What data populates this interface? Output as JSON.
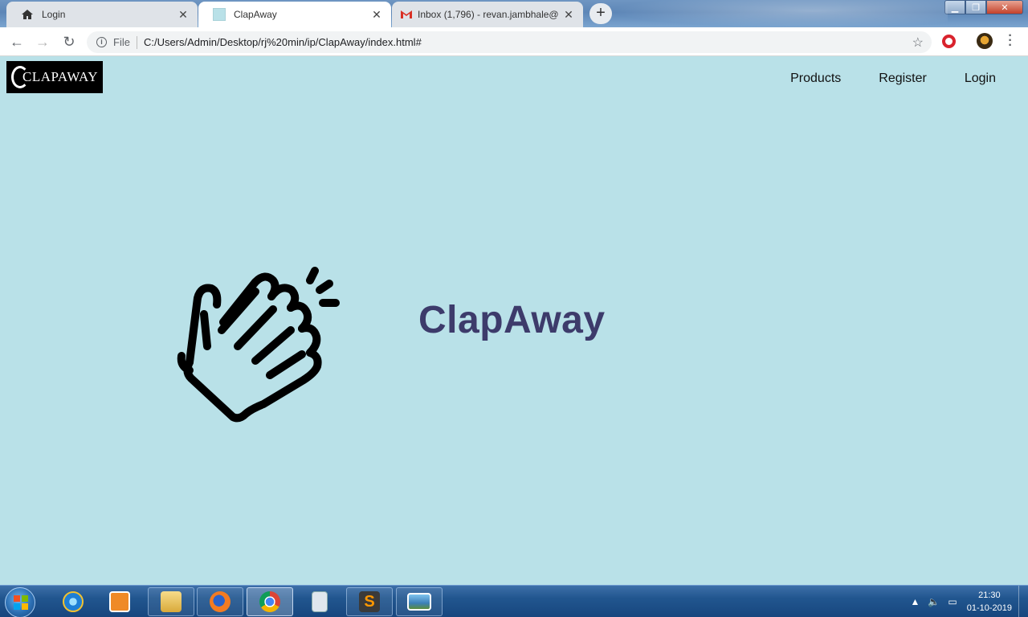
{
  "browser": {
    "tabs": [
      {
        "title": "Login",
        "icon": "home-icon"
      },
      {
        "title": "ClapAway",
        "icon": "page-favicon"
      },
      {
        "title": "Inbox (1,796) - revan.jambhale@",
        "icon": "gmail-icon"
      }
    ],
    "address": {
      "scheme_label": "File",
      "url": "C:/Users/Admin/Desktop/rj%20min/ip/ClapAway/index.html#"
    }
  },
  "page": {
    "logo_text": "CLAPAWAY",
    "nav": [
      "Products",
      "Register",
      "Login"
    ],
    "hero": {
      "title": "ClapAway",
      "icon": "clapping-hands-icon",
      "title_color": "#3d3b6b"
    },
    "background_color": "#b9e1e8"
  },
  "taskbar": {
    "pinned": [
      "internet-explorer-icon",
      "media-player-icon",
      "file-explorer-icon",
      "firefox-icon",
      "chrome-icon",
      "calculator-icon",
      "sublime-text-icon",
      "photo-viewer-icon"
    ],
    "clock": {
      "time": "21:30",
      "date": "01-10-2019"
    }
  }
}
